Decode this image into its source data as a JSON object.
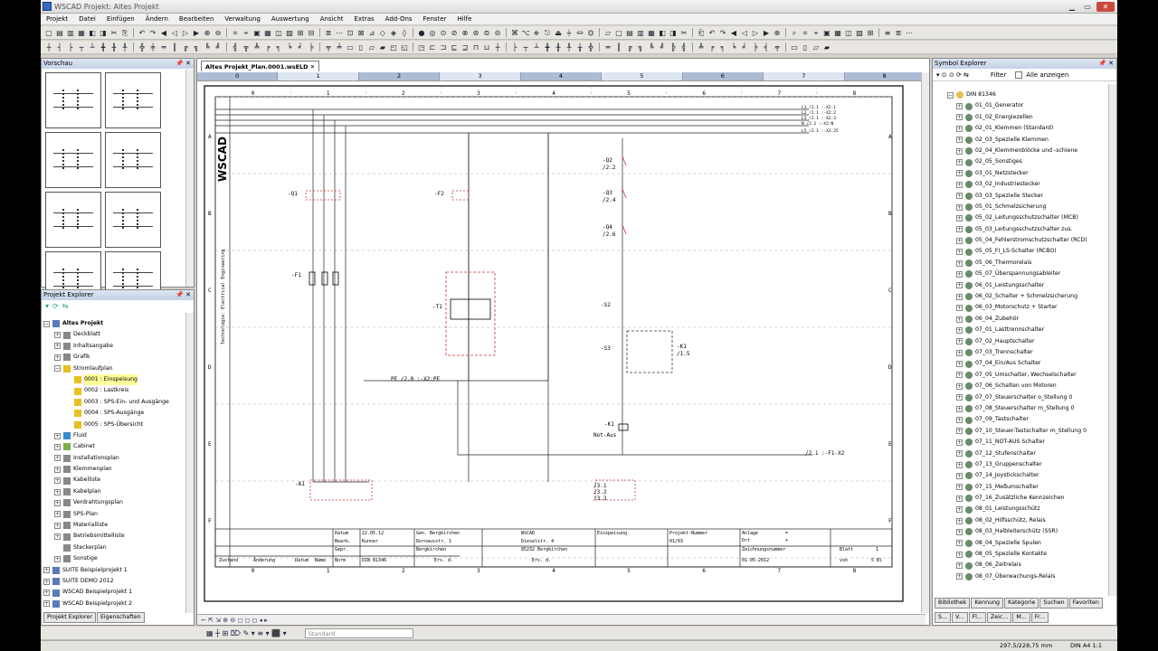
{
  "window": {
    "title": "WSCAD Projekt: Altes Projekt"
  },
  "menu": [
    "Projekt",
    "Datei",
    "Einfügen",
    "Ändern",
    "Bearbeiten",
    "Verwaltung",
    "Auswertung",
    "Ansicht",
    "Extras",
    "Add-Ons",
    "Fenster",
    "Hilfe"
  ],
  "preview": {
    "title": "Vorschau",
    "pin": "📌 ✕"
  },
  "project_explorer": {
    "title": "Projekt Explorer",
    "items": [
      {
        "label": "Altes Projekt",
        "depth": 0,
        "exp": "−",
        "icon": "project"
      },
      {
        "label": "Deckblatt",
        "depth": 1,
        "exp": "+",
        "icon": "page"
      },
      {
        "label": "Inhaltsangabe",
        "depth": 1,
        "exp": "+",
        "icon": "page"
      },
      {
        "label": "Grafik",
        "depth": 1,
        "exp": "+",
        "icon": "page"
      },
      {
        "label": "Stromlaufplan",
        "depth": 1,
        "exp": "−",
        "icon": "bolt"
      },
      {
        "label": "0001 : Einspeisung",
        "depth": 2,
        "exp": "",
        "icon": "bolt",
        "selected": true
      },
      {
        "label": "0002 : Lastkreis",
        "depth": 2,
        "exp": "",
        "icon": "bolt"
      },
      {
        "label": "0003 : SPS-Ein- und Ausgänge",
        "depth": 2,
        "exp": "",
        "icon": "bolt"
      },
      {
        "label": "0004 : SPS-Ausgänge",
        "depth": 2,
        "exp": "",
        "icon": "bolt"
      },
      {
        "label": "0005 : SPS-Übersicht",
        "depth": 2,
        "exp": "",
        "icon": "bolt"
      },
      {
        "label": "Fluid",
        "depth": 1,
        "exp": "+",
        "icon": "fluid"
      },
      {
        "label": "Cabinet",
        "depth": 1,
        "exp": "+",
        "icon": "cabinet"
      },
      {
        "label": "Installationsplan",
        "depth": 1,
        "exp": "+",
        "icon": "page"
      },
      {
        "label": "Klemmenplan",
        "depth": 1,
        "exp": "+",
        "icon": "page"
      },
      {
        "label": "Kabelliste",
        "depth": 1,
        "exp": "+",
        "icon": "page"
      },
      {
        "label": "Kabelplan",
        "depth": 1,
        "exp": "+",
        "icon": "page"
      },
      {
        "label": "Verdrahtungsplan",
        "depth": 1,
        "exp": "+",
        "icon": "page"
      },
      {
        "label": "SPS-Plan",
        "depth": 1,
        "exp": "+",
        "icon": "page"
      },
      {
        "label": "Materialliste",
        "depth": 1,
        "exp": "+",
        "icon": "page"
      },
      {
        "label": "Betriebsmittelliste",
        "depth": 1,
        "exp": "+",
        "icon": "page"
      },
      {
        "label": "Steckerplan",
        "depth": 1,
        "exp": "",
        "icon": "page"
      },
      {
        "label": "Sonstige",
        "depth": 1,
        "exp": "+",
        "icon": "page"
      },
      {
        "label": "SUITE Beispielprojekt 1",
        "depth": 0,
        "exp": "+",
        "icon": "project"
      },
      {
        "label": "SUITE DEMO 2012",
        "depth": 0,
        "exp": "+",
        "icon": "project"
      },
      {
        "label": "WSCAD Beispielprojekt 1",
        "depth": 0,
        "exp": "+",
        "icon": "project"
      },
      {
        "label": "WSCAD Beispielprojekt 2",
        "depth": 0,
        "exp": "+",
        "icon": "project"
      }
    ],
    "tabs": [
      "Projekt Explorer",
      "Eigenschaften"
    ]
  },
  "document": {
    "tab": "Altes Projekt_Plan.0001.wsELD ✕",
    "columns": [
      "0",
      "1",
      "2",
      "3",
      "4",
      "5",
      "6",
      "7",
      "8"
    ],
    "rows": [
      "A",
      "B",
      "C",
      "D",
      "E",
      "F"
    ],
    "labels": {
      "q1": "-Q1",
      "f2": "-F2",
      "f1": "-F1",
      "t1": "-T1",
      "a1": "-A1",
      "q2": "-Q2",
      "q2r": "/2.2",
      "q3": "-Q3",
      "q3r": "/2.4",
      "q4": "-Q4",
      "q4r": "/2.6",
      "s2": "-S2",
      "s3": "-S3",
      "k1": "-K1",
      "k1r": "/1.5",
      "k1b": "-K1",
      "notaus": "Not-Aus",
      "pe": "PE /2.0 :-X2:PE",
      "l1": "L1 /2.1 :-X2:1",
      "l2": "L2 /2.1 :-X2:2",
      "l3": "L3 /2.1 :-X2:3",
      "n": "N /2.1 :-X2:N",
      "l5": "L5 /2.1 :-X2:25",
      "bus": "/2.1 :-F1-X2",
      "tech": "Technologie: Electrical Engineering",
      "logo": "WSCAD",
      "refs1": "/3.1",
      "refs2": "/3.2",
      "refs3": "/3.3"
    },
    "titleblock": {
      "datum_l": "Datum",
      "datum": "22.05.12",
      "bearb_l": "Bearb.",
      "bearb": "Kunner",
      "gepr_l": "Gepr.",
      "norm_l": "Norm",
      "norm": "DIN 81346",
      "firm": "Gen. Bergkirchen",
      "addr1": "Dornausstr. 1",
      "addr2": "Bergkirchen",
      "wscad": "WSCAD",
      "wscad_addr1": "Dieselstr. 4",
      "wscad_addr2": "85232 Bergkirchen",
      "title": "Einspeisung",
      "proj_l": "Projekt-Nummer",
      "proj": "01/03",
      "anlage_l": "Anlage",
      "anlage": "=",
      "ort_l": "Ort",
      "ort": "+",
      "zeich_l": "Zeichnungsnummer",
      "zeich": "01-05-2012",
      "blatt_l": "Blatt",
      "blatt": "1",
      "von_l": "von",
      "von": "5 Bl",
      "zustand": "Zustand",
      "aenderung": "Änderung",
      "datum2": "Datum",
      "name": "Name",
      "norm2": "Norm",
      "ers": "Ers. d.",
      "ersf": "Ers. d."
    }
  },
  "symbol_explorer": {
    "title": "Symbol Explorer",
    "filter": "Filter",
    "alle": "Alle anzeigen",
    "items": [
      "DIN 81346",
      "01_01_Generator",
      "01_02_Energiezellen",
      "02_01_Klemmen (Standard)",
      "02_03_Spezielle Klemmen",
      "02_04_Klemmenblöcke und -schiene",
      "02_05_Sonstiges",
      "03_01_Netzstecker",
      "03_02_Industriestecker",
      "03_03_Spezielle Stecker",
      "05_01_Schmelzsicherung",
      "05_02_Leitungsschutzschalter (MCB)",
      "05_03_Leitungsschutzschalter zus.",
      "05_04_Fehlerstromschutzschalter (RCD)",
      "05_05_FI_LS-Schalter (RCBO)",
      "05_06_Thermorelais",
      "05_07_Überspannungsableiter",
      "06_01_Leistungsschalter",
      "06_02_Schalter + Schmelzsicherung",
      "06_03_Motorschutz + Starter",
      "06_04_Zubehör",
      "07_01_Lasttrennschalter",
      "07_02_Hauptschalter",
      "07_03_Trennschalter",
      "07_04_Ein/Aus Schalter",
      "07_05_Umschalter, Wechselschalter",
      "07_06_Schalten von Motoren",
      "07_07_Steuerschalter o_Stellung 0",
      "07_08_Steuerschalter m_Stellung 0",
      "07_09_Tastschalter",
      "07_10_Steuer-Tastschalter m_Stellung 0",
      "07_11_NOT-AUS Schalter",
      "07_12_Stufenschalter",
      "07_13_Gruppenschalter",
      "07_14_Joystickschalter",
      "07_15_Meßumschalter",
      "07_16_Zusätzliche Kennzeichen",
      "08_01_Leistungsschütz",
      "08_02_Hilfsschütz, Relais",
      "08_03_Halbleiterschütz (SSR)",
      "08_04_Spezielle Spulen",
      "08_05_Spezielle Kontakte",
      "08_06_Zeitrelais",
      "08_07_Überwachungs-Relais"
    ],
    "tabs": [
      "Bibliothek",
      "Kennung",
      "Kategorie",
      "Suchen",
      "Favoriten"
    ],
    "bottom": [
      "S...",
      "V...",
      "Fl...",
      "Zeic...",
      "M...",
      "Fr..."
    ]
  },
  "status": {
    "standard": "Standard",
    "coords": "297,5/228,75 mm",
    "format": "DIN A4  1:1"
  }
}
